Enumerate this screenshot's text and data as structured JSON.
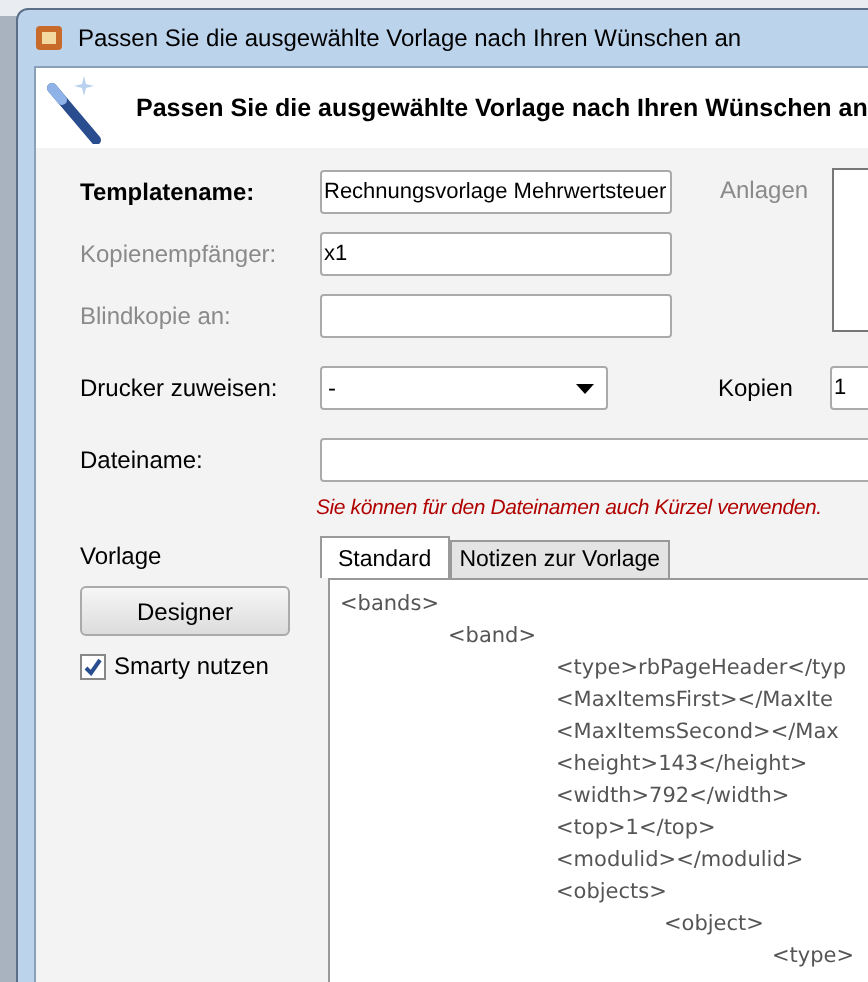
{
  "window": {
    "title": "Passen Sie die ausgewählte Vorlage nach Ihren Wünschen an"
  },
  "header": {
    "title": "Passen Sie die ausgewählte Vorlage nach Ihren Wünschen an"
  },
  "fields": [
    {
      "label": "Templatename:",
      "value": "Rechnungsvorlage Mehrwertsteuer",
      "bold": true,
      "disabled": false
    },
    {
      "label": "Kopienempfänger:",
      "value": "x1",
      "bold": false,
      "disabled": true
    },
    {
      "label": "Blindkopie an:",
      "bold": false,
      "disabled": true
    }
  ],
  "attachments": {
    "label": "Anlagen",
    "disabled": true
  },
  "printer": {
    "label": "Drucker zuweisen:",
    "value": "-"
  },
  "copies": {
    "label": "Kopien",
    "value": "1"
  },
  "filename": {
    "label": "Dateiname:",
    "hint": "Sie können für den Dateinamen auch Kürzel verwenden."
  },
  "template": {
    "label": "Vorlage",
    "designer_button": "Designer",
    "smarty": {
      "label": "Smarty nutzen",
      "checked": true
    }
  },
  "tabs": [
    {
      "label": "Standard",
      "selected": true
    },
    {
      "label": "Notizen zur Vorlage",
      "selected": false
    }
  ],
  "code": [
    {
      "text": "<bands>",
      "children": [
        {
          "text": "<band>",
          "children": [
            {
              "text": "<type>rbPageHeader</typ"
            },
            {
              "text": "<MaxItemsFirst></MaxIte"
            },
            {
              "text": "<MaxItemsSecond></Max"
            },
            {
              "text": "<height>143</height>"
            },
            {
              "text": "<width>792</width>"
            },
            {
              "text": "<top>1</top>"
            },
            {
              "text": "<modulid></modulid>"
            },
            {
              "text": "<objects>",
              "children": [
                {
                  "text": "<object>",
                  "children": [
                    {
                      "text": "<type>"
                    }
                  ]
                }
              ]
            }
          ]
        }
      ]
    }
  ]
}
